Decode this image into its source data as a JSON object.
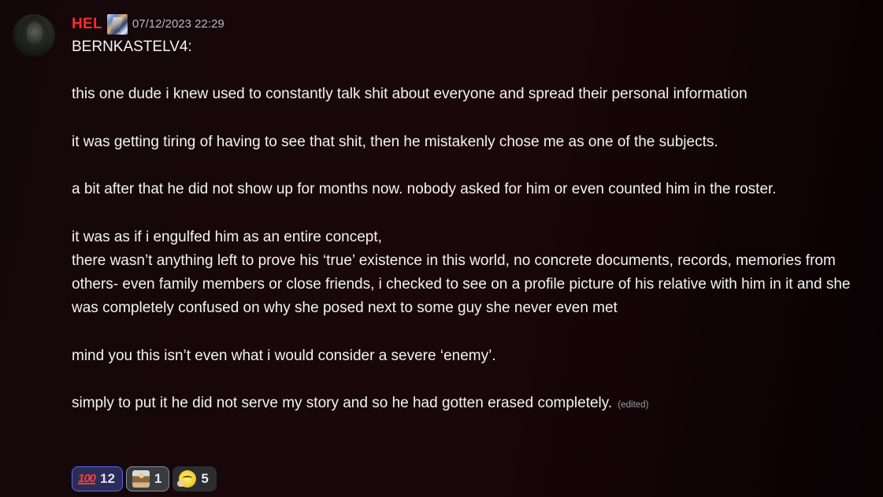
{
  "message": {
    "username": "HEL",
    "timestamp": "07/12/2023 22:29",
    "paragraphs": [
      "BERNKASTELV4:",
      "",
      "this one dude i knew used to constantly talk shit about everyone and spread their personal information",
      "",
      "it was getting tiring of having to see that shit, then he mistakenly chose me as one of the subjects.",
      "",
      "a bit after that he did not show up for months now. nobody asked for him or even counted him in the roster.",
      "",
      "it was as if i engulfed him as an entire concept,",
      "there wasn’t anything left to prove his ‘true’ existence in this world, no concrete documents, records, memories from others- even family members or close friends, i checked to see on a profile picture of his relative with him in it and she was completely confused on why she posed next to some guy she never even met",
      "",
      "mind you this isn’t even what i would consider a severe ‘enemy’.",
      "",
      "simply to put it he did not serve my story and so he had gotten erased completely."
    ],
    "edited_label": "(edited)"
  },
  "reactions": [
    {
      "emoji": "hundred-points-icon",
      "glyph": "100",
      "count": "12",
      "selected": true
    },
    {
      "emoji": "person-at-computer-icon",
      "count": "1",
      "selected": false
    },
    {
      "emoji": "saluting-face-icon",
      "count": "5",
      "selected": false
    }
  ],
  "colors": {
    "username": "#ff2a2a",
    "timestamp": "#b5bac1",
    "text": "#f2f3f5",
    "reaction_selected_border": "#5865f2"
  }
}
